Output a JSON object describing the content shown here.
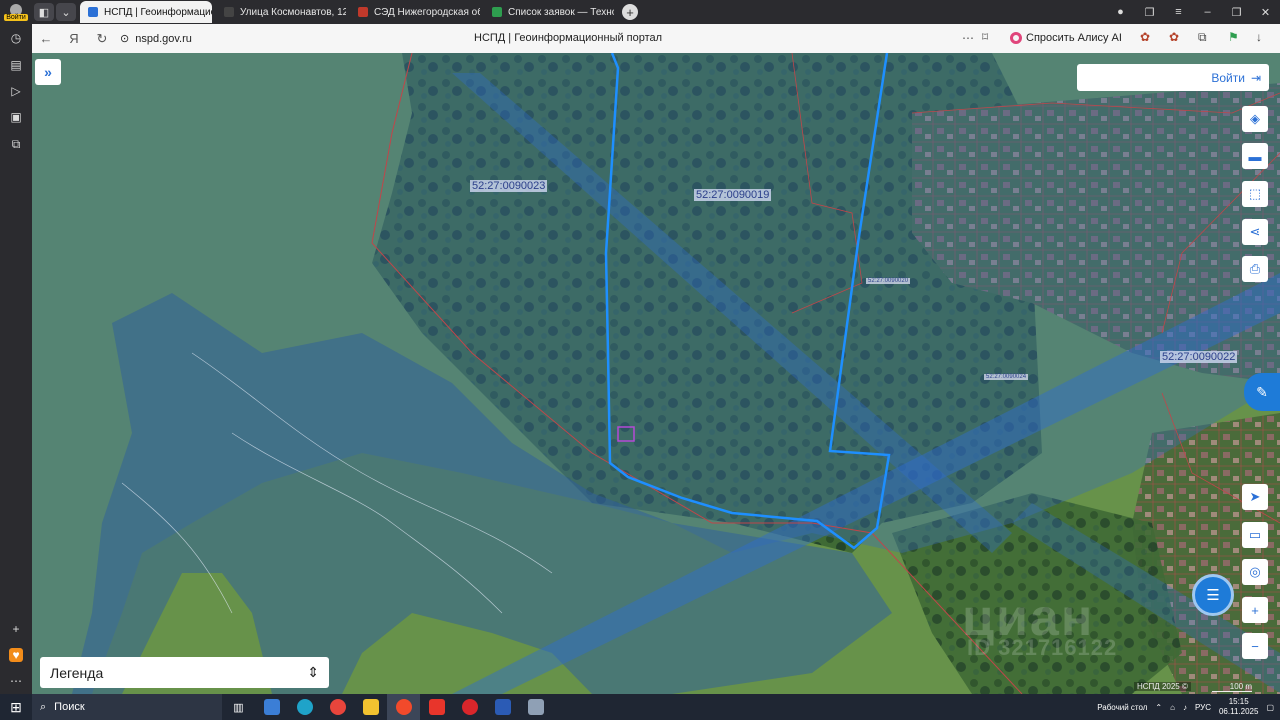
{
  "browser": {
    "profile_label": "Войти",
    "tabs": [
      {
        "label": "НСПД | Геоинформацион",
        "active": true,
        "favicon_color": "#2b70d6"
      },
      {
        "label": "Улица Космонавтов, 12 –",
        "active": false,
        "favicon_color": "#444444"
      },
      {
        "label": "СЭД Нижегородская обл",
        "active": false,
        "favicon_color": "#c0392b"
      },
      {
        "label": "Список заявок — ТехноК",
        "active": false,
        "favicon_color": "#2e9e4f"
      }
    ],
    "new_tab": "+",
    "url": "nspd.gov.ru",
    "page_title": "НСПД | Геоинформационный портал",
    "alice_label": "Спросить Алису AI"
  },
  "map": {
    "login_label": "Войти",
    "legend_label": "Легенда",
    "parcel_labels": [
      {
        "text": "52:27:0090023",
        "size": "normal"
      },
      {
        "text": "52:27:0090019",
        "size": "normal"
      },
      {
        "text": "52:27:0090020",
        "size": "small"
      },
      {
        "text": "52:27:0090024",
        "size": "small"
      },
      {
        "text": "52:27:0090022",
        "size": "normal"
      }
    ],
    "attribution": "НСПД 2025 ©",
    "scale_label": "100 m",
    "watermark": "циан",
    "watermark_id": "ID 321716122",
    "tools": [
      "layers-icon",
      "ruler-icon",
      "select-area-icon",
      "share-icon",
      "print-icon",
      "navigate-icon",
      "picture-in-picture-icon",
      "location-icon",
      "zoom-in-icon",
      "zoom-out-icon"
    ],
    "zoom_in": "+",
    "zoom_out": "−"
  },
  "taskbar": {
    "search_label": "Поиск",
    "desktop_label": "Рабочий стол",
    "language": "РУС",
    "time": "15:15",
    "date": "06.11.2025"
  }
}
